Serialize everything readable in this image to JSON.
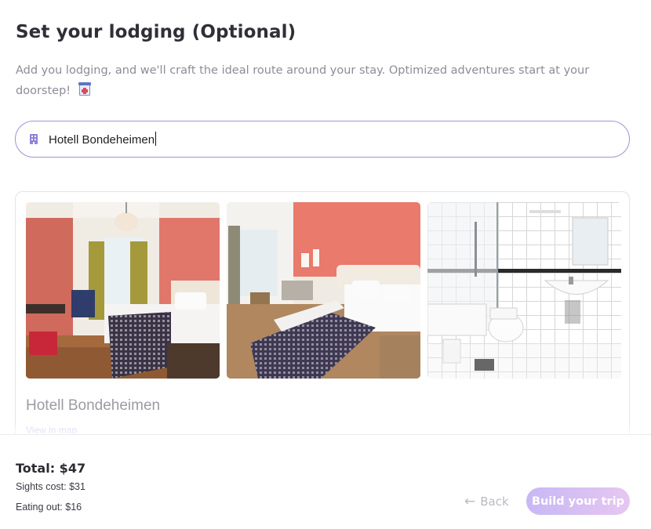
{
  "header": {
    "title": "Set your lodging (Optional)",
    "subtitle": "Add you lodging, and we'll craft the ideal route around your stay. Optimized adventures start at your doorstep!",
    "subtitle_icon": "hotel-emoji-icon"
  },
  "search": {
    "icon": "building-icon",
    "value": "Hotell Bondeheimen",
    "accent": "#9d93de"
  },
  "result": {
    "photos": [
      "hotel-room-photo",
      "hotel-room-photo",
      "bathroom-photo"
    ],
    "name": "Hotell Bondeheimen",
    "map_link": "View in map"
  },
  "footer": {
    "total": "Total: $47",
    "sights": "Sights cost: $31",
    "eating": "Eating out: $16",
    "back_label": "Back",
    "build_label": "Build your trip"
  }
}
